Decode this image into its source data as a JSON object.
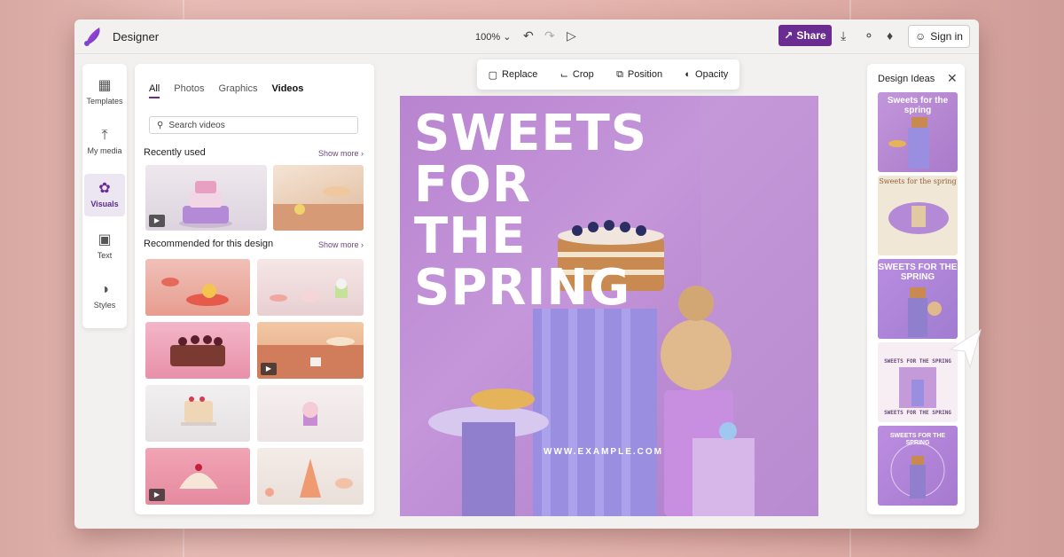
{
  "app": {
    "title": "Designer"
  },
  "titlebar": {
    "zoom": "100%",
    "share_label": "Share",
    "signin_label": "Sign in"
  },
  "rail": {
    "items": [
      {
        "label": "Templates"
      },
      {
        "label": "My media"
      },
      {
        "label": "Visuals"
      },
      {
        "label": "Text"
      },
      {
        "label": "Styles"
      }
    ]
  },
  "panel": {
    "tabs": [
      "All",
      "Photos",
      "Graphics",
      "Videos"
    ],
    "search_placeholder": "Search videos",
    "recently_used": "Recently used",
    "recommended": "Recommended for this design",
    "show_more": "Show more"
  },
  "toolbar": {
    "replace": "Replace",
    "crop": "Crop",
    "position": "Position",
    "opacity": "Opacity"
  },
  "canvas": {
    "headline_1": "SWEETS",
    "headline_2": "FOR",
    "headline_3": "THE",
    "headline_4": "SPRING",
    "website": "WWW.EXAMPLE.COM"
  },
  "ideas": {
    "title": "Design Ideas",
    "idea1": "Sweets for the spring",
    "idea2": "Sweets for the spring",
    "idea3": "SWEETS FOR THE SPRING",
    "idea4a": "SWEETS FOR THE SPRING",
    "idea4b": "SWEETS FOR THE SPRING",
    "idea5": "SWEETS FOR THE SPRING"
  },
  "colors": {
    "accent": "#6b2c91",
    "canvas": "#b884cf"
  }
}
